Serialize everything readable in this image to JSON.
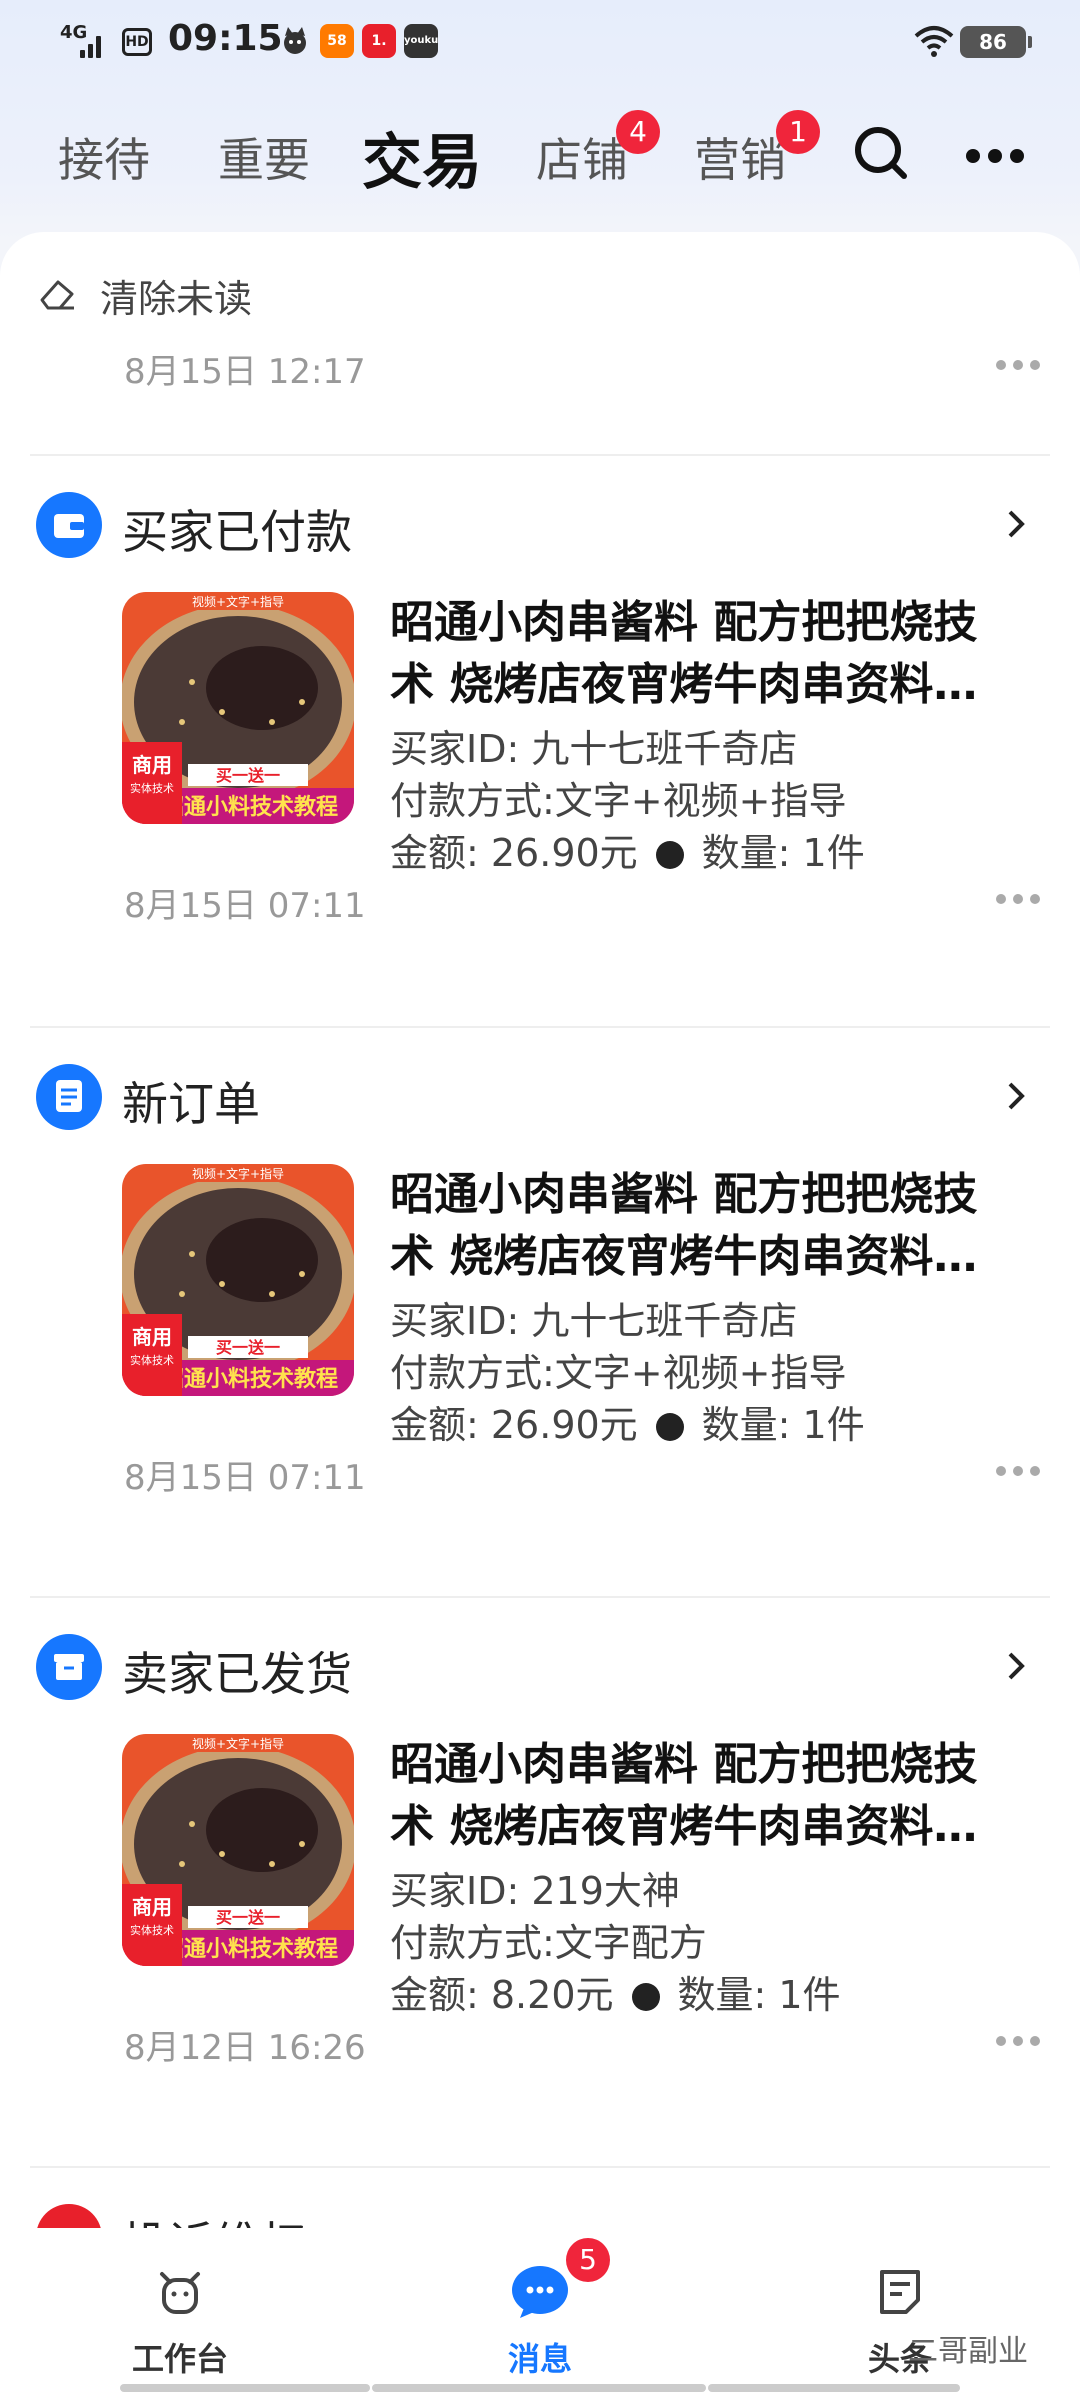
{
  "status_bar": {
    "network": "4G",
    "hd": "HD",
    "time": "09:15",
    "app_icons": [
      "58",
      "1.",
      "youku"
    ],
    "battery": "86"
  },
  "tabs": [
    {
      "label": "接待",
      "badge": ""
    },
    {
      "label": "重要",
      "badge": ""
    },
    {
      "label": "交易",
      "badge": "",
      "active": true
    },
    {
      "label": "店铺",
      "badge": "4"
    },
    {
      "label": "营销",
      "badge": "1"
    }
  ],
  "clear_unread": "清除未读",
  "first_time": "8月15日 12:17",
  "messages": [
    {
      "type": "买家已付款",
      "title": "昭通小肉串酱料 配方把把烧技术 烧烤店夜宵烤牛肉串资料…",
      "buyer": "买家ID: 九十七班千奇店",
      "payment": "付款方式:文字+视频+指导",
      "amount": "金额: 26.90元",
      "quantity": "数量: 1件",
      "time": "8月15日 07:11"
    },
    {
      "type": "新订单",
      "title": "昭通小肉串酱料 配方把把烧技术 烧烤店夜宵烤牛肉串资料…",
      "buyer": "买家ID: 九十七班千奇店",
      "payment": "付款方式:文字+视频+指导",
      "amount": "金额: 26.90元",
      "quantity": "数量: 1件",
      "time": "8月15日 07:11"
    },
    {
      "type": "卖家已发货",
      "title": "昭通小肉串酱料 配方把把烧技术 烧烤店夜宵烤牛肉串资料…",
      "buyer": "买家ID: 219大神",
      "payment": "付款方式:文字配方",
      "amount": "金额: 8.20元",
      "quantity": "数量: 1件",
      "time": "8月12日 16:26"
    }
  ],
  "thumbnail": {
    "top_text": "视频+文字+指导",
    "side_text": "商用",
    "side_sub": "实体技术",
    "promo": "买一送一",
    "banner": "昭通小料技术教程"
  },
  "partial_card_label": "投诉维权",
  "bottom_nav": [
    {
      "label": "工作台",
      "icon": "cow-icon",
      "badge": ""
    },
    {
      "label": "消息",
      "icon": "chat-bubble-icon",
      "badge": "5",
      "active": true
    },
    {
      "label": "头条",
      "icon": "document-icon",
      "badge": ""
    }
  ],
  "watermark": "二哥副业",
  "colors": {
    "accent": "#1677ff",
    "badge": "#f0253b"
  }
}
